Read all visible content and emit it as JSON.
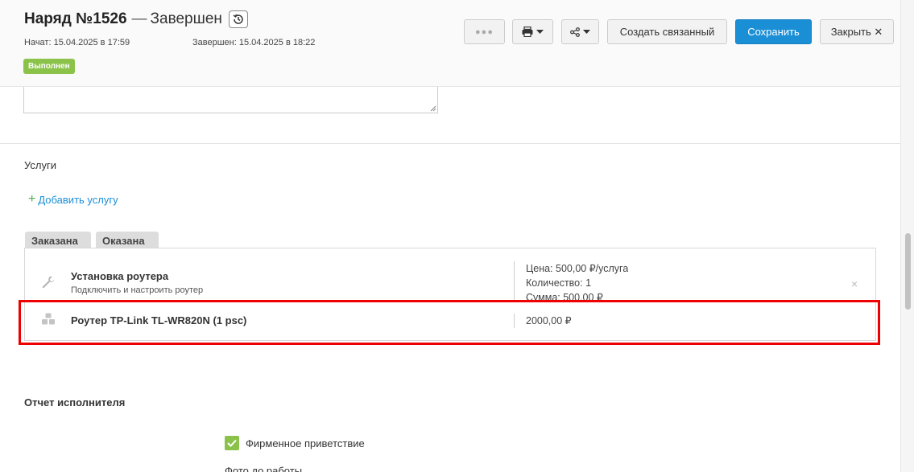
{
  "header": {
    "order_title": "Наряд №1526",
    "dash": "—",
    "status": "Завершен",
    "started": "Начат: 15.04.2025 в 17:59",
    "finished": "Завершен: 15.04.2025 в 18:22",
    "badge": "Выполнен",
    "buttons": {
      "more": "●●●",
      "create_linked": "Создать связанный",
      "save": "Сохранить",
      "close": "Закрыть ✕"
    }
  },
  "services": {
    "title": "Услуги",
    "add_link": "Добавить услугу",
    "add_plus": "+",
    "tabs": [
      "Заказана",
      "Оказана"
    ],
    "items": [
      {
        "name": "Установка роутера",
        "description": "Подключить и настроить роутер",
        "price": "Цена: 500,00 ₽/услуга",
        "quantity": "Количество: 1",
        "sum": "Сумма: 500,00 ₽",
        "icon": "wrench-icon",
        "remove": "×"
      },
      {
        "name": "Роутер TP-Link TL-WR820N (1 psc)",
        "total": "2000,00 ₽",
        "icon": "boxes-icon"
      }
    ]
  },
  "report": {
    "title": "Отчет исполнителя",
    "checkbox_label": "Фирменное приветствие",
    "checkbox_checked": true,
    "photo_label": "Фото до работы"
  },
  "colors": {
    "accent": "#1a8fd6",
    "success": "#8bc34a",
    "highlight": "#ee0000"
  }
}
